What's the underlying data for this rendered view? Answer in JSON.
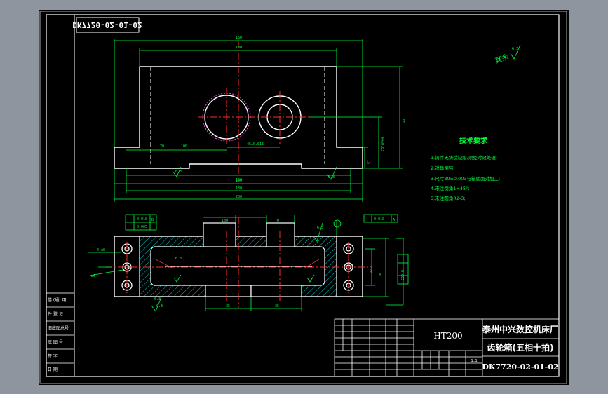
{
  "colors": {
    "viewport_bg": "#8e959f",
    "paper": "#000000",
    "border": "#ffffff",
    "outline": "#ffffff",
    "dimension": "#00ff3c",
    "centerline": "#ff2a2a",
    "hidden": "#ff40ff",
    "hatch": "#00ffff",
    "cyan_text": "#00ffff"
  },
  "stamp": {
    "drawing_code_mirrored": "DK7720-02-01-02"
  },
  "roughness_note": "其余",
  "roughness_value": "6.3",
  "tech_requirements": {
    "title": "技术要求",
    "items": [
      "1.铸件无铸造缺陷,须经时效处理;",
      "2.锐角倒钝;",
      "3.尺寸80±0.003与箱底面对加工;",
      "4.未注倒角1×45°;",
      "5.未注圆角R2-3;"
    ]
  },
  "title_block": {
    "material": "HT200",
    "company": "泰州中兴数控机床厂",
    "part_name": "齿轮箱(五相十拍)",
    "drawing_number": "DK7720-02-01-02",
    "scale": "1:1"
  },
  "side_table": {
    "rows": [
      "借 (通) 用",
      "件 登 记",
      "旧底图总号",
      "底 图 号",
      "签  字",
      "日  期"
    ]
  },
  "front_view": {
    "dims": [
      "150",
      "130",
      "100",
      "70",
      "45±0.015",
      "60",
      "15",
      "44±0.03",
      "6.3",
      "120",
      "130",
      "100",
      "200",
      "6.3"
    ]
  },
  "plan_view": {
    "labels": [
      "A",
      "B"
    ],
    "dims": [
      "130",
      "70",
      "6.3",
      "6.3",
      "6.3",
      "4-∅8",
      "∅6",
      "130",
      "35",
      "35",
      "0.010",
      "0.010",
      "0.005",
      "0.005",
      "80",
      "6.3"
    ]
  }
}
